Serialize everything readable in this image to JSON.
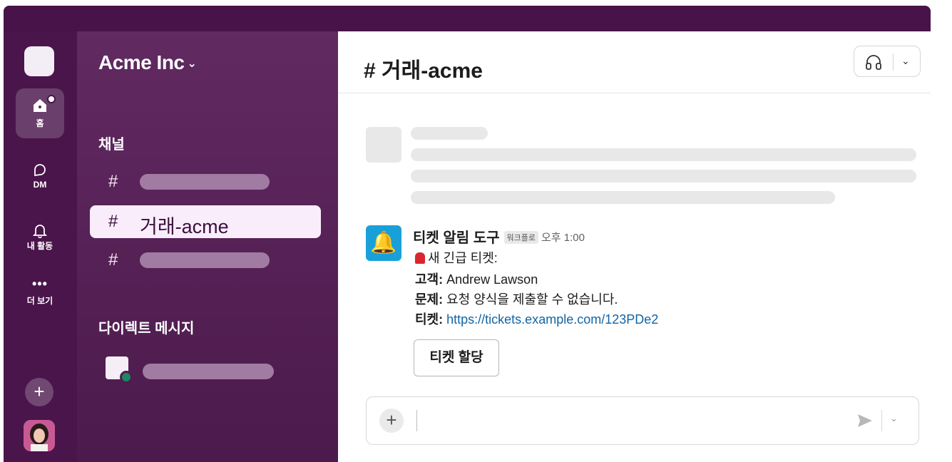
{
  "rail": {
    "home_label": "홈",
    "dm_label": "DM",
    "activity_label": "내 활동",
    "more_label": "더 보기",
    "add_symbol": "+"
  },
  "sidebar": {
    "workspace_name": "Acme Inc",
    "channels_header": "채널",
    "active_channel": "거래-acme",
    "dm_header": "다이렉트 메시지"
  },
  "channel": {
    "title": "# 거래-acme"
  },
  "message": {
    "sender": "티켓 알림 도구",
    "badge": "워크플로",
    "time": "오후 1:00",
    "line1": "새 긴급 티켓:",
    "customer_label": "고객:",
    "customer_value": " Andrew Lawson",
    "issue_label": "문제:",
    "issue_value": " 요청 양식을 제출할 수 없습니다.",
    "ticket_label": "티켓:",
    "ticket_url": "https://tickets.example.com/123PDe2",
    "assign_button": "티켓 할당"
  },
  "colors": {
    "aubergine": "#4a154b",
    "active_bg": "#f9edfb",
    "link": "#1264a3",
    "bot_icon_bg": "#1aa0d9",
    "online": "#1e8760"
  }
}
